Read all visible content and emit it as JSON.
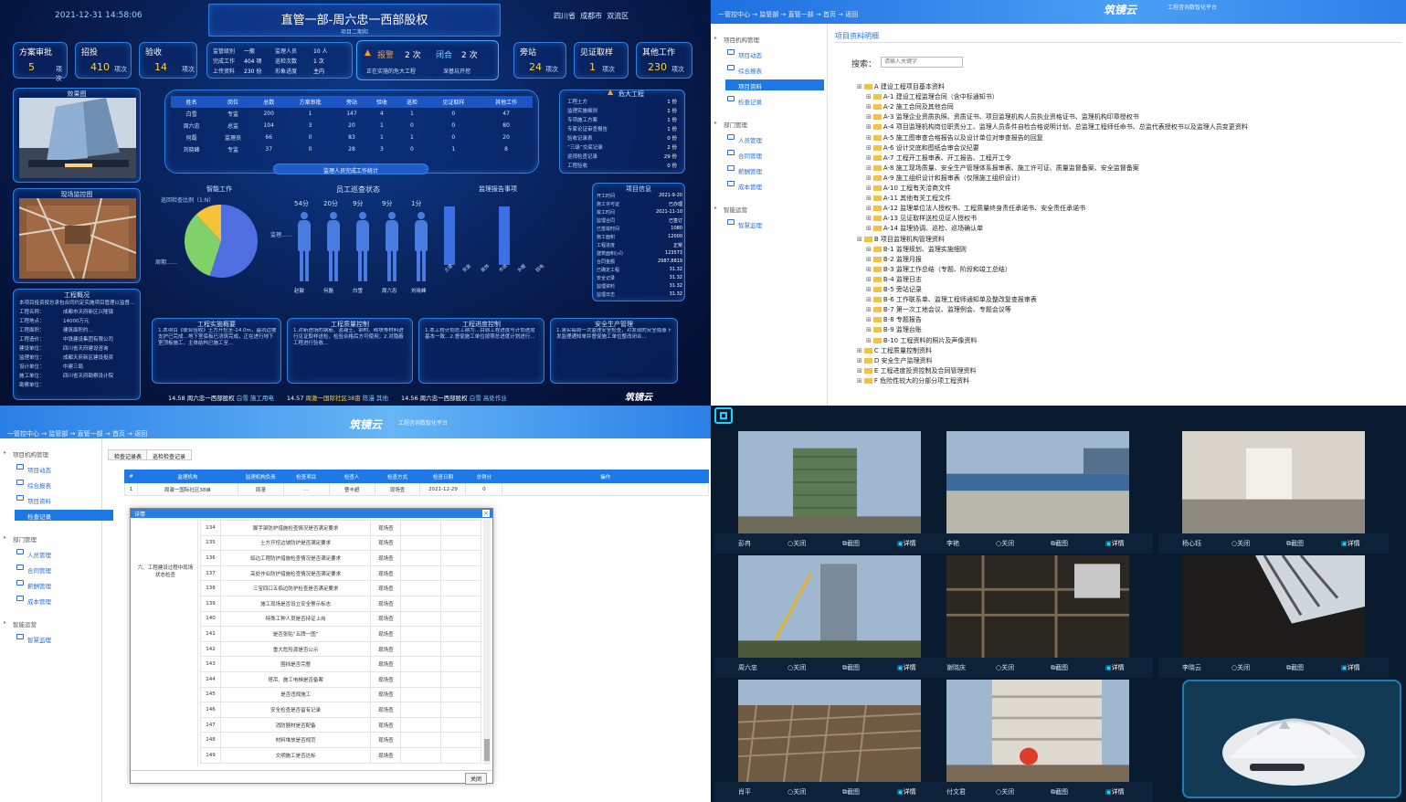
{
  "dashboard": {
    "datetime": "2021-12-31  14:58:06",
    "title": "直管一部-周六忠一西部股权",
    "subtitle": "项目二期和",
    "location": [
      "四川省",
      "成都市",
      "双流区"
    ],
    "stats": [
      {
        "label": "方案审批",
        "value": "5",
        "unit": "项次"
      },
      {
        "label": "招投",
        "value": "410",
        "unit": "项次"
      },
      {
        "label": "验收",
        "value": "14",
        "unit": "项次"
      }
    ],
    "mini_info": [
      [
        "监管级别",
        "一般",
        "监理人员",
        "10 人"
      ],
      [
        "完成工作",
        "404 项",
        "巡检次数",
        "1 次"
      ],
      [
        "上传资料",
        "230 份",
        "形象进度",
        "主内"
      ]
    ],
    "alarm": {
      "label1": "报警",
      "count1": "2 次",
      "label2": "闭合",
      "count2": "2 次",
      "sub1": "正在实施的危大工程",
      "sub2": "深基坑开挖"
    },
    "right_stats": [
      {
        "label": "旁站",
        "value": "24",
        "unit": "项次"
      },
      {
        "label": "见证取样",
        "value": "1",
        "unit": "项次"
      },
      {
        "label": "其他工作",
        "value": "230",
        "unit": "项次"
      }
    ],
    "panels": {
      "effect_img": "效果图",
      "site_img": "现场监控图",
      "overview": "工程概况",
      "danger": "危大工程",
      "table_footer": "监理人员完成工作统计",
      "work_label": "智能工作",
      "staff_status": "员工巡查状态",
      "report": "监理报告事项",
      "project_info": "项目信息",
      "impl": "工程实施概要",
      "quality": "工程质量控制",
      "progress": "工程进度控制",
      "safety": "安全生产管理",
      "pie_label1": "巡回检查比例（1:N）",
      "pie_label2": "监理……",
      "pie_label3": "周期……"
    },
    "table": {
      "headers": [
        "姓名",
        "岗位",
        "总数",
        "方案审批",
        "旁站",
        "验收",
        "巡检",
        "见证取样",
        "其他工作"
      ],
      "rows": [
        [
          "白雪",
          "专监",
          "200",
          "1",
          "147",
          "4",
          "1",
          "0",
          "47"
        ],
        [
          "周六忠",
          "总监",
          "104",
          "3",
          "20",
          "1",
          "0",
          "0",
          "80"
        ],
        [
          "何磊",
          "监理员",
          "66",
          "0",
          "83",
          "1",
          "1",
          "0",
          "20"
        ],
        [
          "刘晓峰",
          "专监",
          "37",
          "0",
          "28",
          "3",
          "0",
          "1",
          "8"
        ]
      ]
    },
    "danger_items": [
      [
        "工程土方",
        "1 份"
      ],
      [
        "监理实施细则",
        "1 份"
      ],
      [
        "专项施工方案",
        "1 份"
      ],
      [
        "专家论证审查报告",
        "1 份"
      ],
      [
        "验收记录表",
        "0 份"
      ],
      [
        "“三级”交底记录",
        "2 份"
      ],
      [
        "巡视检查记录",
        "29 份"
      ],
      [
        "工程验收",
        "0 份"
      ]
    ],
    "staff_counts": [
      "54分",
      "20分",
      "9分",
      "9分",
      "1分"
    ],
    "staff_names": [
      "赵敏",
      "何磊",
      "白雪",
      "周六忠",
      "刘晓峰"
    ],
    "bar_labels": [
      "土建",
      "安装",
      "装饰",
      "市政",
      "水暖",
      "弱电"
    ],
    "bar_values": [
      1,
      0,
      0,
      1,
      0,
      0
    ],
    "pie_shares": [
      0.55,
      0.33,
      0.12
    ],
    "overview_lines": [
      "  本项目投资按总承包合同约定实施项目管理以监督…",
      "工程名称：",
      "工程地点：",
      "工程面积：",
      "工程造价：",
      "建设单位：",
      "监理单位：",
      "设计单位：",
      "施工单位：",
      "勘察单位："
    ],
    "overview_values": [
      "成都市天府新区兴隆镇",
      "14000万元",
      "建筑面积约…",
      "中铁建设集团有限公司",
      "四川省天府建设咨询",
      "成都天府新区建设投资",
      "中建三局",
      "四川省天府勘察设计院"
    ],
    "project_info": [
      [
        "开工时间",
        "2021-9-20"
      ],
      [
        "施工许可证",
        "已办理"
      ],
      [
        "竣工时间",
        "2021-11-10"
      ],
      [
        "监理合同",
        "已签订"
      ],
      [
        "已签竣时间",
        "1080"
      ],
      [
        "施工面积",
        "12000"
      ],
      [
        "工程进度",
        "正常"
      ],
      [
        "建筑面积(㎡)",
        "123573"
      ],
      [
        "合同金额",
        "2987.8819"
      ],
      [
        "已确定工程",
        "31.32"
      ],
      [
        "安全记录",
        "31.32"
      ],
      [
        "监理资料",
        "31.32"
      ],
      [
        "监理日志",
        "31.32"
      ]
    ],
    "impl_text": "  1.本项目《联合验收》土方开挖至-14.0m，基坑边坡支护已完成…地下室底板已浇筑完成，正在进行地下室顶板施工，主体结构已施工至…",
    "quality_text": "  1.对新进场的钢筋、混凝土、钢材、砌块等材料进行见证取样送检，检验合格后方可使用；2.对隐蔽工程进行验收…",
    "progress_text": "  1.本工程计划总工期为…目前工程进度与计划进度基本一致…2.督促施工单位按照总进度计划进行…",
    "safety_text": "  1.落实每周一次监理安全检查，对发现的安全隐患下发监理通知单并督促施工单位整改闭合…",
    "ticker": [
      {
        "time": "14.58",
        "text": "周六忠一西部股权",
        "who": "白雪",
        "act": "施工用电"
      },
      {
        "time": "14.57",
        "text": "周激一国际社区38亩",
        "who": "陈漫",
        "act": "其他"
      },
      {
        "time": "14.56",
        "text": "周六忠一西部股权",
        "who": "白雪",
        "act": "高处作业"
      }
    ],
    "brand": "筑镜云"
  },
  "tree_view": {
    "breadcrumb": "一管控中心 → 监管部 → 直管一部 → 首页 → 返回",
    "logo": "筑镜云",
    "slogan": "工程咨询数智化平台",
    "sidebar": [
      {
        "type": "group",
        "label": "项目机构管理"
      },
      {
        "type": "item",
        "label": "项目动态"
      },
      {
        "type": "item",
        "label": "综合报表"
      },
      {
        "type": "active",
        "label": "项目资料"
      },
      {
        "type": "item",
        "label": "检查记录"
      },
      {
        "type": "group",
        "label": "部门管理"
      },
      {
        "type": "item",
        "label": "人员管理"
      },
      {
        "type": "item",
        "label": "合同管理"
      },
      {
        "type": "item",
        "label": "薪酬管理"
      },
      {
        "type": "item",
        "label": "成本管理"
      },
      {
        "type": "group",
        "label": "智能运营"
      },
      {
        "type": "item",
        "label": "智慧监理"
      }
    ],
    "section_title": "项目资料明细",
    "search_label": "搜索：",
    "search_placeholder": "请输入关键字",
    "nodes": [
      {
        "d": 0,
        "t": "A 建设工程项目基本资料"
      },
      {
        "d": 1,
        "t": "A-1 建设工程监理合同（含中标通知书）"
      },
      {
        "d": 1,
        "t": "A-2 施工合同及其他合同"
      },
      {
        "d": 1,
        "t": "A-3 监理企业资质执照、资质证书、项目监理机构人员执业资格证书、监理机构印章授权书"
      },
      {
        "d": 1,
        "t": "A-4 项目监理机构岗位职责分工、监理人员条件自检合格说明计划、总监理工程师任命书、总监代表授权书以及监理人员变更资料"
      },
      {
        "d": 1,
        "t": "A-5 施工图审查合格报告以及设计单位对审查报告的回复"
      },
      {
        "d": 1,
        "t": "A-6 设计交底和图纸会审会议纪要"
      },
      {
        "d": 1,
        "t": "A-7 工程开工报审表、开工报告、工程开工令"
      },
      {
        "d": 1,
        "t": "A-8 施工现场质量、安全生产管理体系报审表、施工许可证、质量监督备案、安全监督备案"
      },
      {
        "d": 1,
        "t": "A-9 施工组织设计和报审表（仅限施工组织设计）"
      },
      {
        "d": 1,
        "t": "A-10 工程有关洽商文件"
      },
      {
        "d": 1,
        "t": "A-11 其他有关工程文件"
      },
      {
        "d": 1,
        "t": "A-12 监理单位法人授权书、工程质量终身责任承诺书、安全责任承诺书"
      },
      {
        "d": 1,
        "t": "A-13 见证取样送检见证人授权书"
      },
      {
        "d": 1,
        "t": "A-14 监理协调、巡检、巡场确认单"
      },
      {
        "d": 0,
        "t": "B 项目监理机构管理资料"
      },
      {
        "d": 1,
        "t": "B-1 监理规划、监理实施细则"
      },
      {
        "d": 1,
        "t": "B-2 监理月报"
      },
      {
        "d": 1,
        "t": "B-3 监理工作总结（专题、阶段和竣工总结）"
      },
      {
        "d": 1,
        "t": "B-4 监理日志"
      },
      {
        "d": 1,
        "t": "B-5 旁站记录"
      },
      {
        "d": 1,
        "t": "B-6 工作联系单、监理工程师通知单及整改复查报审表"
      },
      {
        "d": 1,
        "t": "B-7 第一次工地会议、监理例会、专题会议等"
      },
      {
        "d": 1,
        "t": "B-8 专题报告"
      },
      {
        "d": 1,
        "t": "B-9 监理台账"
      },
      {
        "d": 1,
        "t": "B-10 工程资料的照片及声像资料"
      },
      {
        "d": 0,
        "t": "C 工程质量控制资料"
      },
      {
        "d": 0,
        "t": "D 安全生产监理资料"
      },
      {
        "d": 0,
        "t": "E 工程进度投资控制及合同管理资料"
      },
      {
        "d": 0,
        "t": "F 危险性较大的分部分项工程资料"
      }
    ]
  },
  "check_view": {
    "breadcrumb": "一管控中心 → 监管部 → 直管一部 → 首页 → 返回",
    "logo": "筑镜云",
    "slogan": "工程咨询数智化平台",
    "sidebar": [
      {
        "type": "group",
        "label": "项目机构管理"
      },
      {
        "type": "item",
        "label": "项目动态"
      },
      {
        "type": "item",
        "label": "综合报表"
      },
      {
        "type": "item",
        "label": "项目资料"
      },
      {
        "type": "active",
        "label": "检查记录"
      },
      {
        "type": "group",
        "label": "部门管理"
      },
      {
        "type": "item",
        "label": "人员管理"
      },
      {
        "type": "item",
        "label": "合同管理"
      },
      {
        "type": "item",
        "label": "薪酬管理"
      },
      {
        "type": "item",
        "label": "成本管理"
      },
      {
        "type": "group",
        "label": "智能运营"
      },
      {
        "type": "item",
        "label": "智慧监理"
      }
    ],
    "tabs": [
      "检查记录表",
      "巡检检查记录"
    ],
    "headers": [
      "#",
      "监理机构",
      "监理机构负责",
      "检查项目",
      "检查人",
      "检查方式",
      "检查日期",
      "总得分",
      "操作"
    ],
    "row": [
      "1",
      "周激一国际社区38亩",
      "周漫",
      "…",
      "曹丰超",
      "现场查",
      "2021-12-29",
      "0",
      ""
    ],
    "modal_title": "详情",
    "modal_group": "六、工程建设过程中现场状态检查",
    "modal_rows": [
      [
        "134",
        "脚手架防护措施检查情况是否满足要求",
        "现场查"
      ],
      [
        "135",
        "土方开挖边坡防护是否满足要求",
        "现场查"
      ],
      [
        "136",
        "临边工程防护措施检查情况是否满足要求",
        "现场查"
      ],
      [
        "137",
        "高处作业防护措施检查情况是否满足要求",
        "现场查"
      ],
      [
        "138",
        "三宝四口五临边防护检查是否满足要求",
        "现场查"
      ],
      [
        "139",
        "施工现场是否设立安全警示标志",
        "现场查"
      ],
      [
        "140",
        "特殊工种人员是否持证上岗",
        "现场查"
      ],
      [
        "141",
        "是否张贴“五牌一图”",
        "现场查"
      ],
      [
        "142",
        "重大危险源是否公示",
        "现场查"
      ],
      [
        "143",
        "围挡是否完整",
        "现场查"
      ],
      [
        "144",
        "塔吊、施工电梯是否备案",
        "现场查"
      ],
      [
        "145",
        "是否违规施工",
        "现场查"
      ],
      [
        "146",
        "安全检查是否留有记录",
        "现场查"
      ],
      [
        "147",
        "消防器材是否配备",
        "现场查"
      ],
      [
        "148",
        "材料堆放是否规范",
        "现场查"
      ],
      [
        "149",
        "文明施工是否达标",
        "现场查"
      ]
    ],
    "close_label": "关闭"
  },
  "cameras": {
    "labels": [
      [
        "彭冉",
        "关闭",
        "截图",
        "详情"
      ],
      [
        "李艳",
        "关闭",
        "截图",
        "详情"
      ],
      [
        "杨心钰",
        "关闭",
        "截图",
        "详情"
      ],
      [
        "周六忠",
        "关闭",
        "截图",
        "详情"
      ],
      [
        "谢晓庆",
        "关闭",
        "截图",
        "详情"
      ],
      [
        "李晓云",
        "关闭",
        "截图",
        "详情"
      ],
      [
        "肖平",
        "关闭",
        "截图",
        "详情"
      ],
      [
        "付文君",
        "关闭",
        "截图",
        "详情"
      ]
    ],
    "colors": {
      "sky": "#9fb8cf",
      "building": "#5d7a55",
      "floor": "#8a8670",
      "accent": "#1dd3ff"
    }
  }
}
